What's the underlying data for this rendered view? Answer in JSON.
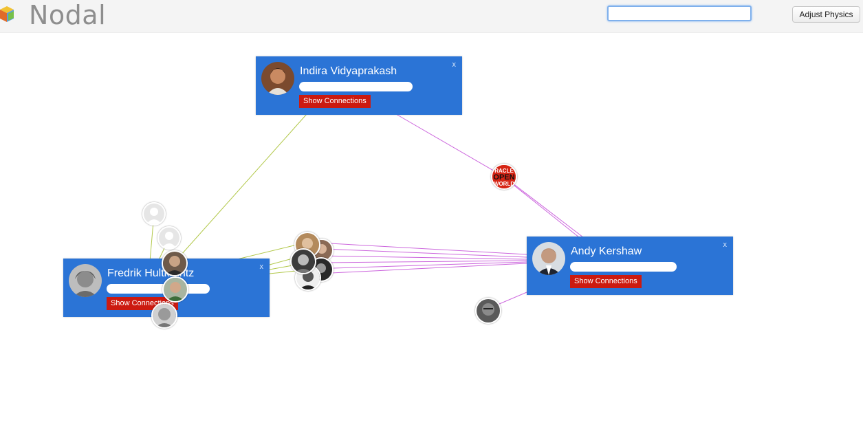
{
  "app": {
    "logo_text": "Nodal"
  },
  "toolbar": {
    "search_value": "",
    "adjust_physics_label": "Adjust Physics"
  },
  "cards": {
    "indira": {
      "name": "Indira Vidyaprakash",
      "button": "Show Connections",
      "close": "x"
    },
    "fredrik": {
      "name": "Fredrik Hultkrantz",
      "button": "Show Connections",
      "close": "x"
    },
    "andy": {
      "name": "Andy Kershaw",
      "button": "Show Connections",
      "close": "x"
    }
  },
  "oracle_node": {
    "lines": [
      "RACLE",
      "OPEN",
      "WORLD"
    ]
  },
  "colors": {
    "card_bg": "#2b74d6",
    "button_red": "#cc1a10",
    "edge_green": "#b2c84a",
    "edge_purple": "#cc66dd"
  }
}
